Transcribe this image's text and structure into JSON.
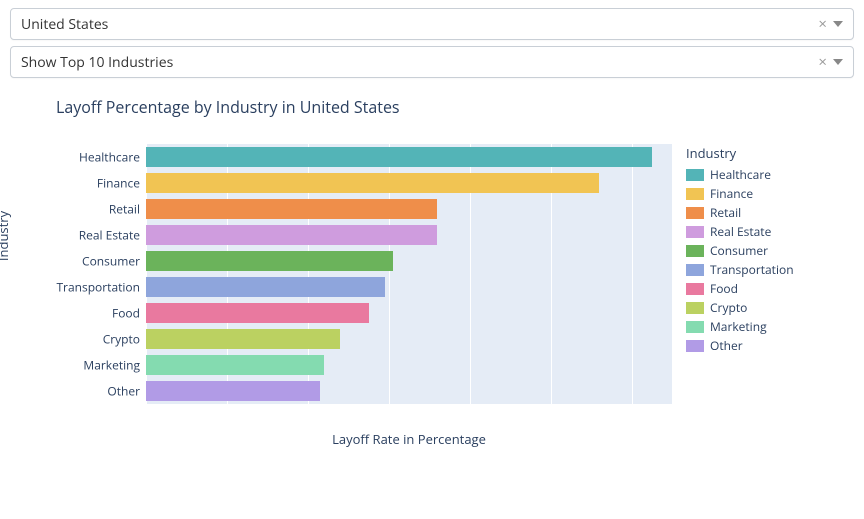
{
  "filters": {
    "country": "United States",
    "industries": "Show Top 10 Industries"
  },
  "chart_data": {
    "type": "bar",
    "orientation": "horizontal",
    "title": "Layoff Percentage by Industry in United States",
    "xlabel": "Layoff Rate in Percentage",
    "ylabel": "Industry",
    "xlim": [
      0,
      13
    ],
    "xticks": [
      0,
      2,
      4,
      6,
      8,
      10,
      12
    ],
    "categories": [
      "Healthcare",
      "Finance",
      "Retail",
      "Real Estate",
      "Consumer",
      "Transportation",
      "Food",
      "Crypto",
      "Marketing",
      "Other"
    ],
    "values": [
      12.5,
      11.2,
      7.2,
      7.2,
      6.1,
      5.9,
      5.5,
      4.8,
      4.4,
      4.3
    ],
    "colors": [
      "#53b4b7",
      "#f1c453",
      "#ef8e4a",
      "#cf9cde",
      "#6bb35b",
      "#8ea5dc",
      "#e9799f",
      "#bbd161",
      "#84dbb0",
      "#b19be6"
    ],
    "legend_title": "Industry"
  }
}
